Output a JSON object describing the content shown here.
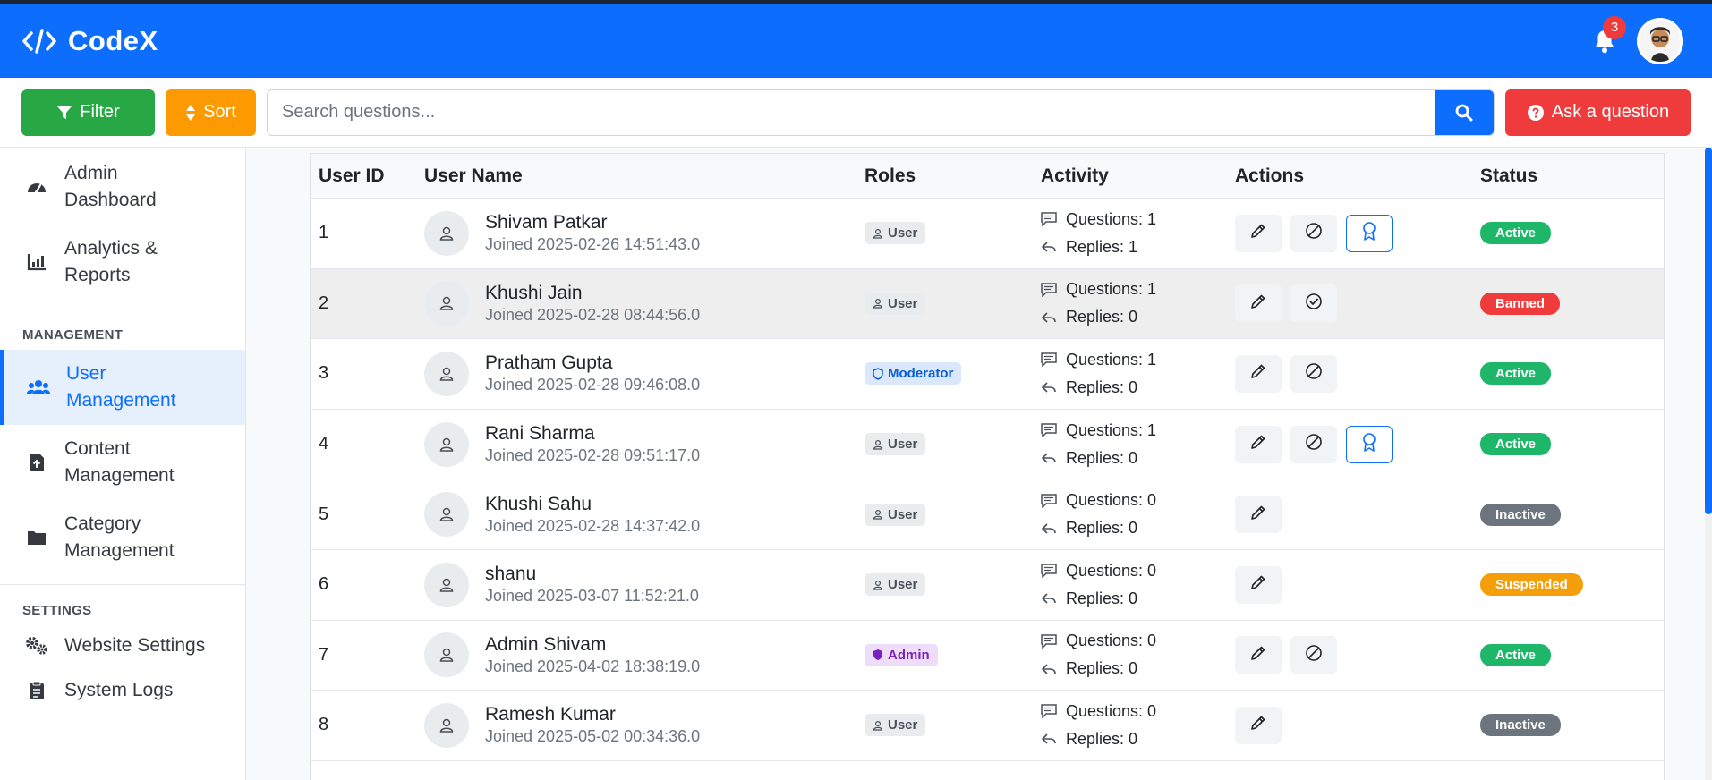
{
  "app": {
    "name": "CodeX"
  },
  "topbar": {
    "notifications_count": "3",
    "colors": {
      "bar": "#0d6efd"
    }
  },
  "toolbar": {
    "filter_label": "Filter",
    "sort_label": "Sort",
    "search_placeholder": "Search questions...",
    "ask_label": "Ask a question"
  },
  "sidebar": {
    "items_top": [
      {
        "label": "Admin Dashboard",
        "icon": "gauge-icon"
      },
      {
        "label": "Analytics & Reports",
        "icon": "chart-icon"
      }
    ],
    "management_title": "MANAGEMENT",
    "management_items": [
      {
        "label": "User Management",
        "icon": "users-icon",
        "active": true
      },
      {
        "label": "Content Management",
        "icon": "file-icon"
      },
      {
        "label": "Category Management",
        "icon": "folder-icon"
      }
    ],
    "settings_title": "SETTINGS",
    "settings_items": [
      {
        "label": "Website Settings",
        "icon": "gears-icon"
      },
      {
        "label": "System Logs",
        "icon": "clipboard-icon"
      }
    ]
  },
  "table": {
    "headers": [
      "User ID",
      "User Name",
      "Roles",
      "Activity",
      "Actions",
      "Status"
    ],
    "rows": [
      {
        "id": "1",
        "name": "Shivam Patkar",
        "joined": "Joined 2025-02-26 14:51:43.0",
        "role": "User",
        "questions": "Questions: 1",
        "replies": "Replies: 1",
        "status": "Active"
      },
      {
        "id": "2",
        "name": "Khushi Jain",
        "joined": "Joined 2025-02-28 08:44:56.0",
        "role": "User",
        "questions": "Questions: 1",
        "replies": "Replies: 0",
        "status": "Banned"
      },
      {
        "id": "3",
        "name": "Pratham Gupta",
        "joined": "Joined 2025-02-28 09:46:08.0",
        "role": "Moderator",
        "questions": "Questions: 1",
        "replies": "Replies: 0",
        "status": "Active"
      },
      {
        "id": "4",
        "name": "Rani Sharma",
        "joined": "Joined 2025-02-28 09:51:17.0",
        "role": "User",
        "questions": "Questions: 1",
        "replies": "Replies: 0",
        "status": "Active"
      },
      {
        "id": "5",
        "name": "Khushi Sahu",
        "joined": "Joined 2025-02-28 14:37:42.0",
        "role": "User",
        "questions": "Questions: 0",
        "replies": "Replies: 0",
        "status": "Inactive"
      },
      {
        "id": "6",
        "name": "shanu",
        "joined": "Joined 2025-03-07 11:52:21.0",
        "role": "User",
        "questions": "Questions: 0",
        "replies": "Replies: 0",
        "status": "Suspended"
      },
      {
        "id": "7",
        "name": "Admin Shivam",
        "joined": "Joined 2025-04-02 18:38:19.0",
        "role": "Admin",
        "questions": "Questions: 0",
        "replies": "Replies: 0",
        "status": "Active"
      },
      {
        "id": "8",
        "name": "Ramesh Kumar",
        "joined": "Joined 2025-05-02 00:34:36.0",
        "role": "User",
        "questions": "Questions: 0",
        "replies": "Replies: 0",
        "status": "Inactive"
      }
    ]
  }
}
